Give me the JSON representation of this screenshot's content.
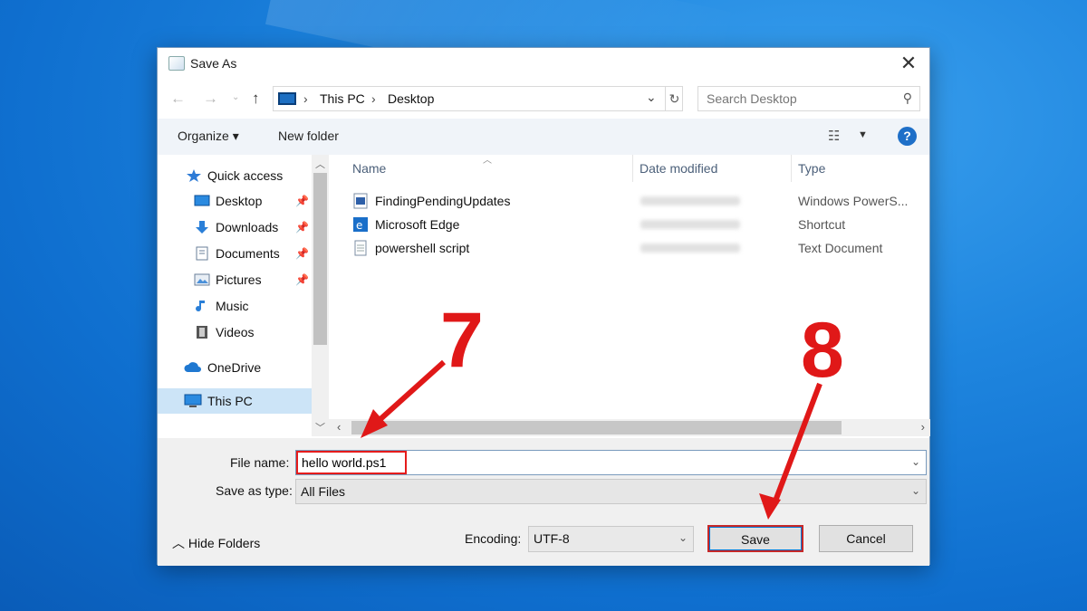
{
  "dialog": {
    "title": "Save As",
    "close_symbol": "✕"
  },
  "address": {
    "crumb_pc": "This PC",
    "crumb_desktop": "Desktop",
    "separator": "›",
    "search_placeholder": "Search Desktop"
  },
  "toolbar": {
    "organize_label": "Organize ▾",
    "new_folder_label": "New folder",
    "help_label": "?"
  },
  "nav": {
    "items": [
      {
        "label": "Quick access",
        "icon": "star-icon"
      },
      {
        "label": "Desktop",
        "icon": "desktop-icon",
        "pinned": true
      },
      {
        "label": "Downloads",
        "icon": "download-icon",
        "pinned": true
      },
      {
        "label": "Documents",
        "icon": "documents-icon",
        "pinned": true
      },
      {
        "label": "Pictures",
        "icon": "pictures-icon",
        "pinned": true
      },
      {
        "label": "Music",
        "icon": "music-icon"
      },
      {
        "label": "Videos",
        "icon": "videos-icon"
      },
      {
        "label": "OneDrive",
        "icon": "onedrive-icon"
      },
      {
        "label": "This PC",
        "icon": "this-pc-icon",
        "selected": true
      }
    ]
  },
  "files": {
    "columns": [
      "Name",
      "Date modified",
      "Type"
    ],
    "rows": [
      {
        "name": "FindingPendingUpdates",
        "type": "Windows PowerS...",
        "icon": "powershell-file-icon"
      },
      {
        "name": "Microsoft Edge",
        "type": "Shortcut",
        "icon": "edge-shortcut-icon"
      },
      {
        "name": "powershell script",
        "type": "Text Document",
        "icon": "text-file-icon"
      }
    ]
  },
  "form": {
    "file_name_label": "File name:",
    "file_name_value": "hello world.ps1",
    "save_type_label": "Save as type:",
    "save_type_value": "All Files",
    "hide_folders_label": "Hide Folders",
    "encoding_label": "Encoding:",
    "encoding_value": "UTF-8",
    "save_label": "Save",
    "cancel_label": "Cancel"
  },
  "annotations": {
    "step_a": "7",
    "step_b": "8",
    "color": "#e01818"
  }
}
